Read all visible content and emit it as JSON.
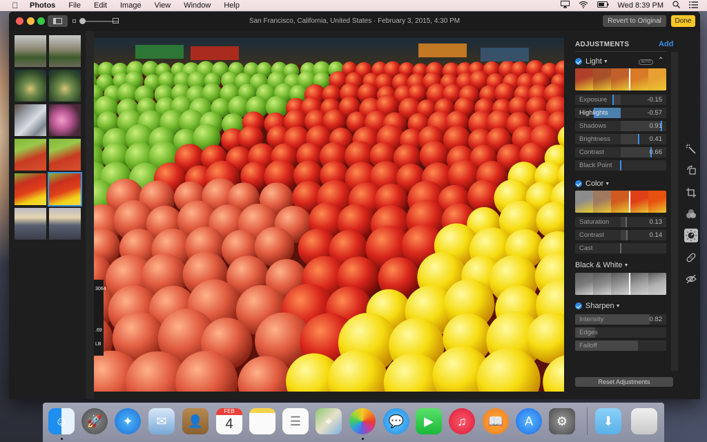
{
  "menubar": {
    "apple_icon": "apple-logo",
    "app_name": "Photos",
    "menus": [
      "File",
      "Edit",
      "Image",
      "View",
      "Window",
      "Help"
    ],
    "status_icons": [
      "airplay-icon",
      "wifi-icon",
      "battery-icon"
    ],
    "clock": "Wed 8:39 PM",
    "spotlight_icon": "search-icon",
    "notification_icon": "list-icon"
  },
  "window": {
    "title": "San Francisco, California, United States  ·  February 3, 2015, 4:30 PM",
    "revert_label": "Revert to Original",
    "done_label": "Done",
    "accent_color": "#f6c629"
  },
  "thumbnails": [
    {
      "subject": "park path",
      "selected": false
    },
    {
      "subject": "park path",
      "selected": false
    },
    {
      "subject": "hanging flowers",
      "selected": false
    },
    {
      "subject": "hanging flowers",
      "selected": false
    },
    {
      "subject": "fabric",
      "selected": false
    },
    {
      "subject": "pink hydrangeas",
      "selected": false
    },
    {
      "subject": "apples green and red",
      "selected": false
    },
    {
      "subject": "apples green and red",
      "selected": false
    },
    {
      "subject": "apples red and yellow",
      "selected": false
    },
    {
      "subject": "apples red and yellow",
      "selected": true
    },
    {
      "subject": "sunset city",
      "selected": false
    },
    {
      "subject": "sunset city",
      "selected": false
    }
  ],
  "photo": {
    "subject": "Red, green and yellow apples at market",
    "price_tag_text": [
      "3064",
      ".69",
      "LB"
    ]
  },
  "adjustments": {
    "heading": "ADJUSTMENTS",
    "add_label": "Add",
    "light": {
      "title": "Light",
      "enabled": true,
      "auto_label": "AUTO",
      "sliders": [
        {
          "label": "Exposure",
          "value": "-0.15",
          "position": 0.42
        },
        {
          "label": "Highlights",
          "value": "-0.57",
          "position": 0.21
        },
        {
          "label": "Shadows",
          "value": "0.91",
          "position": 0.95
        },
        {
          "label": "Brightness",
          "value": "0.41",
          "position": 0.7
        },
        {
          "label": "Contrast",
          "value": "0.66",
          "position": 0.83
        },
        {
          "label": "Black Point",
          "value": "",
          "position": 0.5
        }
      ]
    },
    "color": {
      "title": "Color",
      "enabled": true,
      "sliders": [
        {
          "label": "Saturation",
          "value": "0.13",
          "position": 0.56
        },
        {
          "label": "Contrast",
          "value": "0.14",
          "position": 0.57
        },
        {
          "label": "Cast",
          "value": "",
          "position": 0.5
        }
      ]
    },
    "bw": {
      "title": "Black & White",
      "enabled": false
    },
    "sharpen": {
      "title": "Sharpen",
      "enabled": true,
      "sliders": [
        {
          "label": "Intensity",
          "value": "0.82",
          "position": 0.82
        },
        {
          "label": "Edges",
          "value": "",
          "position": 0.22
        },
        {
          "label": "Falloff",
          "value": "",
          "position": 0.69
        }
      ]
    },
    "reset_label": "Reset Adjustments"
  },
  "tools": [
    "enhance-wand-icon",
    "rotate-icon",
    "crop-icon",
    "filters-icon",
    "adjust-icon",
    "retouch-bandage-icon",
    "red-eye-icon"
  ],
  "dock": [
    {
      "name": "Finder",
      "running": true
    },
    {
      "name": "Launchpad",
      "running": false
    },
    {
      "name": "Safari",
      "running": false
    },
    {
      "name": "Mail",
      "running": false
    },
    {
      "name": "Contacts",
      "running": false
    },
    {
      "name": "Calendar",
      "running": false,
      "month": "FEB",
      "day": "4"
    },
    {
      "name": "Notes",
      "running": false
    },
    {
      "name": "Reminders",
      "running": false
    },
    {
      "name": "Maps",
      "running": false
    },
    {
      "name": "Photos",
      "running": true
    },
    {
      "name": "Messages",
      "running": false
    },
    {
      "name": "FaceTime",
      "running": false
    },
    {
      "name": "iTunes",
      "running": false
    },
    {
      "name": "iBooks",
      "running": false
    },
    {
      "name": "App Store",
      "running": false
    },
    {
      "name": "System Preferences",
      "running": false
    },
    {
      "name": "Downloads",
      "running": false
    },
    {
      "name": "Trash",
      "running": false
    }
  ]
}
